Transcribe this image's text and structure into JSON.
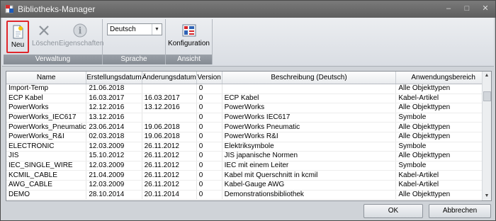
{
  "window": {
    "title": "Bibliotheks-Manager",
    "minimize": "–",
    "maximize": "□",
    "close": "✕"
  },
  "ribbon": {
    "groups": [
      {
        "label": "Verwaltung",
        "buttons": [
          "Neu",
          "Löschen",
          "Eigenschaften"
        ]
      },
      {
        "label": "Sprache",
        "combo_value": "Deutsch"
      },
      {
        "label": "Ansicht",
        "buttons": [
          "Konfiguration"
        ]
      }
    ]
  },
  "table": {
    "columns": [
      "Name",
      "Erstellungsdatum",
      "Änderungsdatum",
      "Version",
      "Beschreibung (Deutsch)",
      "Anwendungsbereich"
    ],
    "rows": [
      [
        "Import-Temp",
        "21.06.2018",
        "",
        "0",
        "",
        "Alle Objekttypen"
      ],
      [
        "ECP Kabel",
        "16.03.2017",
        "16.03.2017",
        "0",
        "ECP Kabel",
        "Kabel-Artikel"
      ],
      [
        "PowerWorks",
        "12.12.2016",
        "13.12.2016",
        "0",
        "PowerWorks",
        "Alle Objekttypen"
      ],
      [
        "PowerWorks_IEC617",
        "13.12.2016",
        "",
        "0",
        "PowerWorks IEC617",
        "Symbole"
      ],
      [
        "PowerWorks_Pneumatic",
        "23.06.2014",
        "19.06.2018",
        "0",
        "PowerWorks Pneumatic",
        "Alle Objekttypen"
      ],
      [
        "PowerWorks_R&I",
        "02.03.2018",
        "19.06.2018",
        "0",
        "PowerWorks R&I",
        "Alle Objekttypen"
      ],
      [
        "ELECTRONIC",
        "12.03.2009",
        "26.11.2012",
        "0",
        "Elektriksymbole",
        "Symbole"
      ],
      [
        "JIS",
        "15.10.2012",
        "26.11.2012",
        "0",
        "JIS japanische Normen",
        "Alle Objekttypen"
      ],
      [
        "IEC_SINGLE_WIRE",
        "12.03.2009",
        "26.11.2012",
        "0",
        "IEC mit einem Leiter",
        "Symbole"
      ],
      [
        "KCMIL_CABLE",
        "21.04.2009",
        "26.11.2012",
        "0",
        "Kabel mit Querschnitt in kcmil",
        "Kabel-Artikel"
      ],
      [
        "AWG_CABLE",
        "12.03.2009",
        "26.11.2012",
        "0",
        "Kabel-Gauge AWG",
        "Kabel-Artikel"
      ],
      [
        "DEMO",
        "28.10.2014",
        "20.11.2014",
        "0",
        "Demonstrationsbibliothek",
        "Alle Objekttypen"
      ]
    ]
  },
  "footer": {
    "ok": "OK",
    "cancel": "Abbrechen"
  }
}
